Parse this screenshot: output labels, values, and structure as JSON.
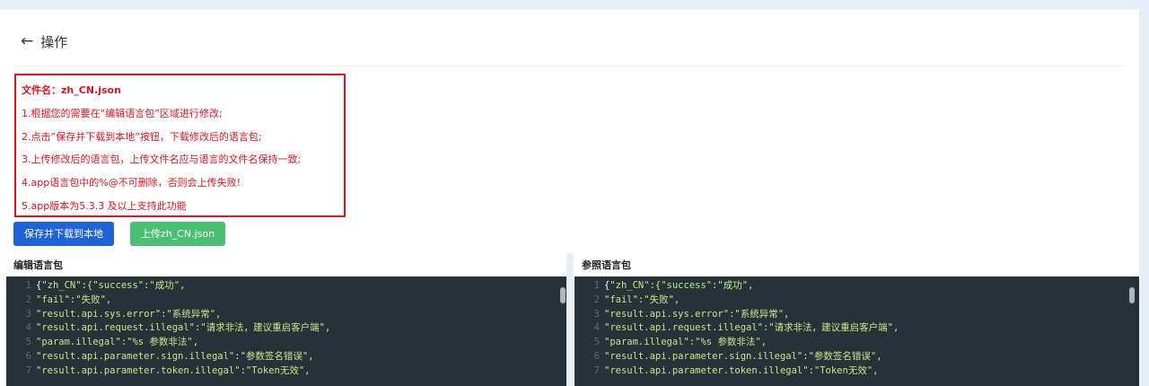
{
  "header": {
    "back_icon": "←",
    "title": "操作"
  },
  "notice": {
    "filename_line": "文件名：zh_CN.json",
    "items": [
      "1.根据您的需要在“编辑语言包”区域进行修改;",
      "2.点击“保存并下载到本地”按钮，下载修改后的语言包;",
      "3.上传修改后的语言包，上传文件名应与语言的文件名保持一致;",
      "4.app语言包中的%@不可删除，否则会上传失败!",
      "5.app版本为5.3.3 及以上支持此功能"
    ]
  },
  "buttons": {
    "save": "保存并下载到本地",
    "upload": "上传zh_CN.json"
  },
  "editor_left": {
    "title": "编辑语言包",
    "lines": [
      {
        "n": "1",
        "pre": "{",
        "code": "\"zh_CN\":{\"success\":\"成功\","
      },
      {
        "n": "2",
        "pre": "",
        "code": "\"fail\":\"失败\","
      },
      {
        "n": "3",
        "pre": "",
        "code": "\"result.api.sys.error\":\"系统异常\","
      },
      {
        "n": "4",
        "pre": "",
        "code": "\"result.api.request.illegal\":\"请求非法，建议重启客户端\","
      },
      {
        "n": "5",
        "pre": "",
        "code": "\"param.illegal\":\"%s 参数非法\","
      },
      {
        "n": "6",
        "pre": "",
        "code": "\"result.api.parameter.sign.illegal\":\"参数签名错误\","
      },
      {
        "n": "7",
        "pre": "",
        "code": "\"result.api.parameter.token.illegal\":\"Token无效\","
      }
    ]
  },
  "editor_right": {
    "title": "参照语言包",
    "lines": [
      {
        "n": "1",
        "pre": "{",
        "code": "\"zh_CN\":{\"success\":\"成功\","
      },
      {
        "n": "2",
        "pre": "",
        "code": "\"fail\":\"失败\","
      },
      {
        "n": "3",
        "pre": "",
        "code": "\"result.api.sys.error\":\"系统异常\","
      },
      {
        "n": "4",
        "pre": "",
        "code": "\"result.api.request.illegal\":\"请求非法，建议重启客户端\","
      },
      {
        "n": "5",
        "pre": "",
        "code": "\"param.illegal\":\"%s 参数非法\","
      },
      {
        "n": "6",
        "pre": "",
        "code": "\"result.api.parameter.sign.illegal\":\"参数签名错误\","
      },
      {
        "n": "7",
        "pre": "",
        "code": "\"result.api.parameter.token.illegal\":\"Token无效\","
      }
    ]
  }
}
